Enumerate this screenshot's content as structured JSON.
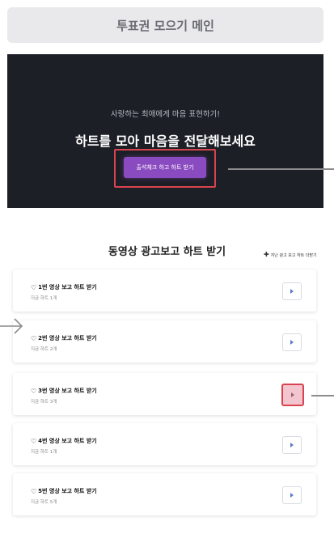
{
  "header": {
    "title": "투표권 모으기 메인"
  },
  "banner": {
    "subtitle": "사랑하는 최애에게 마음 표현하기!",
    "headline": "하트를 모아 마음을 전달해보세요",
    "attend_button": "출석체크 하고 하트 받기"
  },
  "section": {
    "title": "동영상 광고보고 하트 받기",
    "past_link": "지난 광고 보고 하트 더받기"
  },
  "cards": [
    {
      "title": "1번 영상 보고 하트 받기",
      "sub": "지금 하트 1개"
    },
    {
      "title": "2번 영상 보고 하트 받기",
      "sub": "지금 하트 2개"
    },
    {
      "title": "3번 영상 보고 하트 받기",
      "sub": "지금 하트 3개"
    },
    {
      "title": "4번 영상 보고 하트 받기",
      "sub": "지금 하트 1개"
    },
    {
      "title": "5번 영상 보고 하트 받기",
      "sub": "지금 하트 5개"
    }
  ],
  "icons": {
    "heart": "heart-outline-icon",
    "play": "play-icon",
    "plus": "plus-icon"
  },
  "colors": {
    "banner_bg": "#1d1f27",
    "accent_purple": "#8a4bc0",
    "highlight_red": "#d9434f",
    "play_blue": "#5a7bc6"
  }
}
